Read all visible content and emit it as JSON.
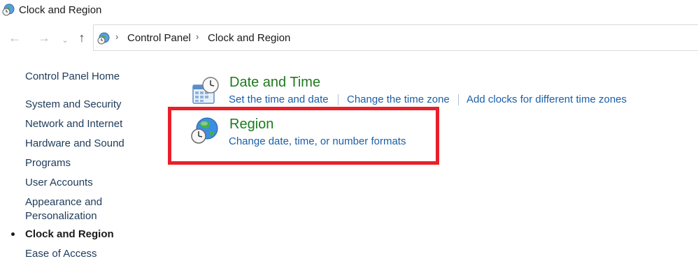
{
  "window": {
    "title": "Clock and Region"
  },
  "navigation": {
    "back_icon": "arrow-left-icon",
    "forward_icon": "arrow-right-icon",
    "recent_icon": "chevron-down-icon",
    "up_icon": "arrow-up-icon"
  },
  "address_bar": {
    "crumbs": [
      "Control Panel",
      "Clock and Region"
    ]
  },
  "sidebar": {
    "items": [
      {
        "label": "Control Panel Home"
      },
      {
        "label": "System and Security"
      },
      {
        "label": "Network and Internet"
      },
      {
        "label": "Hardware and Sound"
      },
      {
        "label": "Programs"
      },
      {
        "label": "User Accounts"
      },
      {
        "label": "Appearance and"
      },
      {
        "label": "Personalization"
      },
      {
        "label": "Clock and Region"
      },
      {
        "label": "Ease of Access"
      }
    ]
  },
  "main": {
    "categories": [
      {
        "title": "Date and Time",
        "icon": "date-time-clock-icon",
        "tasks": [
          "Set the time and date",
          "Change the time zone",
          "Add clocks for different time zones"
        ]
      },
      {
        "title": "Region",
        "icon": "globe-clock-icon",
        "tasks": [
          "Change date, time, or number formats"
        ]
      }
    ]
  },
  "colors": {
    "category_title": "#1e7a1e",
    "task_link": "#1a5fa8",
    "highlight": "#e8202a"
  }
}
